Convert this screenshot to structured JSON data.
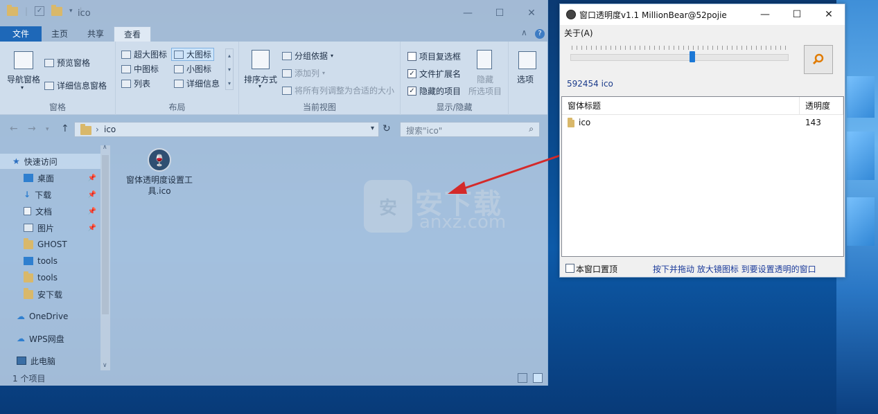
{
  "explorer": {
    "title": "ico",
    "tabs": [
      "文件",
      "主页",
      "共享",
      "查看"
    ],
    "ribbon": {
      "panes": {
        "nav_pane": "导航窗格",
        "preview": "预览窗格",
        "details": "详细信息窗格",
        "label": "窗格"
      },
      "layout": {
        "items": [
          "超大图标",
          "大图标",
          "中图标",
          "小图标",
          "列表",
          "详细信息"
        ],
        "label": "布局"
      },
      "current_view": {
        "sort": "排序方式",
        "group_by": "分组依据",
        "add_column": "添加列",
        "fit_columns": "将所有列调整为合适的大小",
        "label": "当前视图"
      },
      "show_hide": {
        "item_checkbox": "项目复选框",
        "file_ext": "文件扩展名",
        "hidden_items": "隐藏的项目",
        "hide": "隐藏",
        "hide_selected": "所选项目",
        "label": "显示/隐藏"
      },
      "options": "选项"
    },
    "address": "ico",
    "search_placeholder": "搜索\"ico\"",
    "nav": [
      "快速访问",
      "桌面",
      "下载",
      "文档",
      "图片",
      "GHOST",
      "tools",
      "tools",
      "安下载",
      "OneDrive",
      "WPS网盘",
      "此电脑"
    ],
    "file": {
      "name": "窗体透明度设置工具.ico"
    },
    "status": "1 个项目"
  },
  "watermark": {
    "main": "安下载",
    "sub": "anxz.com",
    "shield": "安"
  },
  "tool": {
    "title": "窗口透明度v1.1    MillionBear@52pojie",
    "menu_about": "关于(A)",
    "slider_value": 0.56,
    "handle_text": "592454 ico",
    "columns": [
      "窗体标题",
      "透明度"
    ],
    "rows": [
      {
        "title": "ico",
        "opacity": "143"
      }
    ],
    "topmost_label": "本窗口置顶",
    "hint": "按下并拖动 放大镜图标 到要设置透明的窗口"
  },
  "colors": {
    "accent": "#1e68b8",
    "arrow": "#d42a2a",
    "slider": "#1c78d6"
  }
}
